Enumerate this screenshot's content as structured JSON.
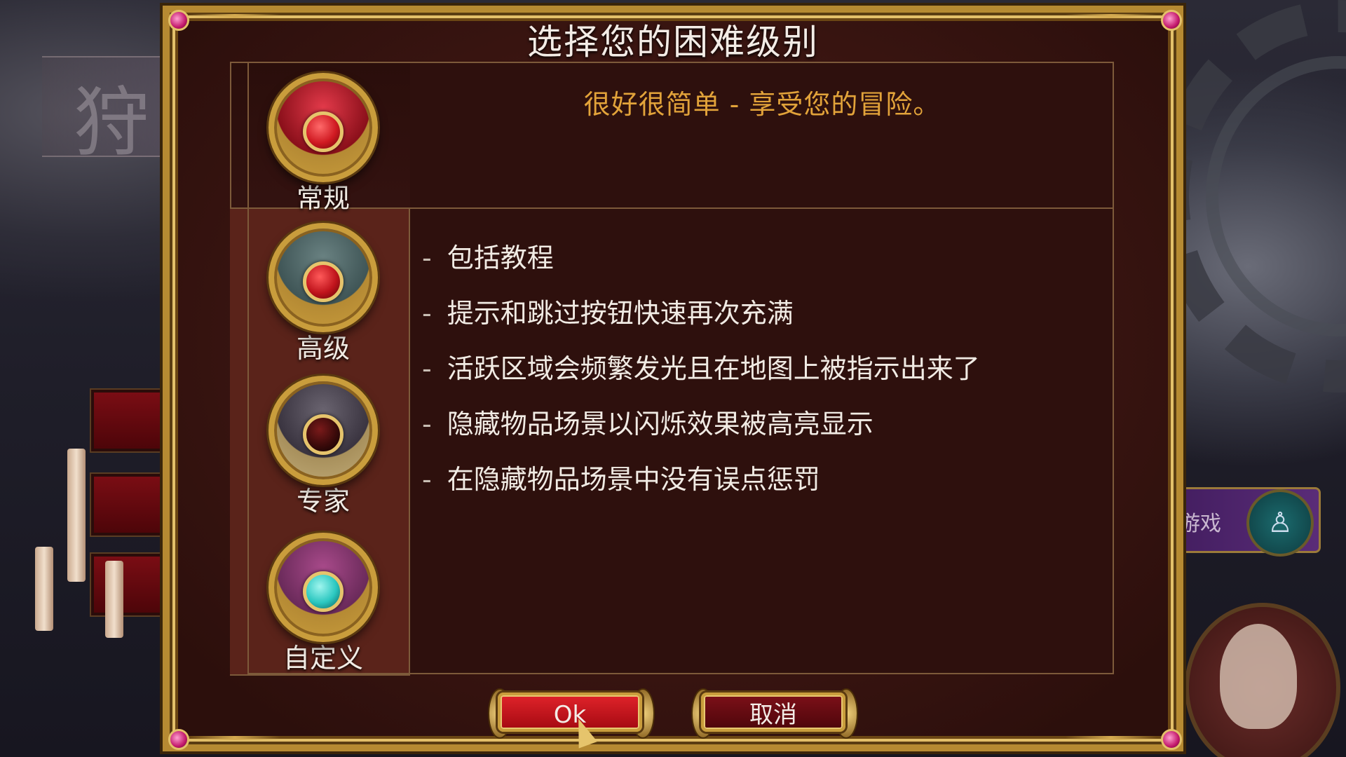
{
  "background": {
    "title_char": "狩",
    "play_label": "游戏",
    "play_icon": "figure-icon"
  },
  "dialog": {
    "title": "选择您的困难级别",
    "subtitle": "很好很简单 - 享受您的冒险。",
    "difficulties": [
      {
        "label": "常规",
        "selected": true,
        "gem_color": "#d01a22",
        "bg_color": "#8a0f1a"
      },
      {
        "label": "高级",
        "selected": false,
        "gem_color": "#c0141c",
        "bg_color": "#3f5556"
      },
      {
        "label": "专家",
        "selected": false,
        "gem_color": "#3a0a0a",
        "bg_color": "#3a3440"
      },
      {
        "label": "自定义",
        "selected": false,
        "gem_color": "#2bc7c0",
        "bg_color": "#6a2a5a"
      }
    ],
    "features": [
      {
        "dash": "-",
        "text": "包括教程"
      },
      {
        "dash": "-",
        "text": "提示和跳过按钮快速再次充满"
      },
      {
        "dash": "-",
        "text": "活跃区域会频繁发光且在地图上被指示出来了"
      },
      {
        "dash": "-",
        "text": "隐藏物品场景以闪烁效果被高亮显示"
      },
      {
        "dash": "-",
        "text": "在隐藏物品场景中没有误点惩罚"
      }
    ],
    "ok_label": "Ok",
    "cancel_label": "取消"
  },
  "colors": {
    "frame_gold": "#c99d3c",
    "accent_orange": "#e2a33a",
    "ok_red": "#e0232a",
    "cancel_red": "#7c1018"
  }
}
